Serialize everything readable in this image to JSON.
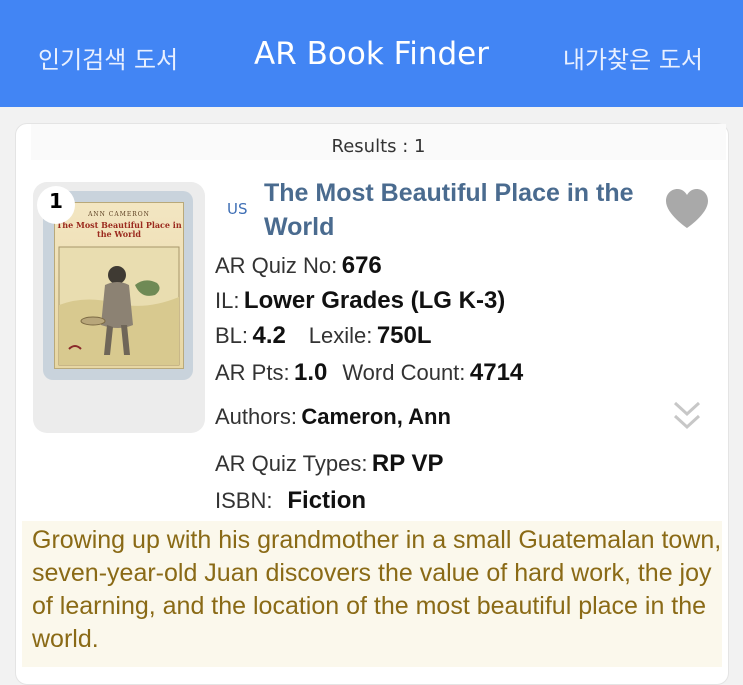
{
  "header": {
    "left_link": "인기검색 도서",
    "title": "AR Book Finder",
    "right_link": "내가찾은 도서",
    "bg_color": "#4285f4"
  },
  "results": {
    "text": "Results : 1"
  },
  "book": {
    "rank": "1",
    "country": "US",
    "title": "The Most Beautiful Place in the World",
    "cover": {
      "author_line": "ANN CAMERON",
      "title_text": "The Most Beautiful Place in the World"
    },
    "quiz_no_label": "AR Quiz No:",
    "quiz_no": "676",
    "il_label": "IL:",
    "il": "Lower Grades (LG K-3)",
    "bl_label": "BL:",
    "bl": "4.2",
    "lexile_label": "Lexile:",
    "lexile": "750L",
    "pts_label": "AR Pts:",
    "pts": "1.0",
    "wc_label": "Word Count:",
    "wc": "4714",
    "authors_label": "Authors:",
    "authors": "Cameron, Ann",
    "quiz_types_label": "AR Quiz Types:",
    "quiz_types": "RP VP",
    "isbn_label": "ISBN:",
    "isbn": "Fiction",
    "description": "Growing up with his grandmother in a small Guatemalan town, seven-year-old Juan discovers the value of hard work, the joy of learning, and the location of the most beautiful place in the world."
  },
  "icons": {
    "favorite": "heart-icon",
    "expand": "double-chevron-down-icon"
  }
}
